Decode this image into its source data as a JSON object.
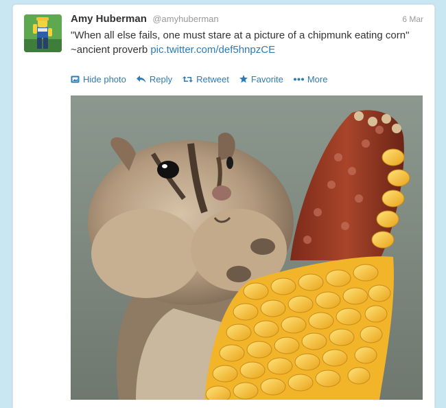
{
  "tweet": {
    "name": "Amy Huberman",
    "handle": "@amyhuberman",
    "date": "6 Mar",
    "text_line1": "\"When all else fails, one must stare at a picture of a chipmunk eating corn\"",
    "text_line2_prefix": "~ancient proverb ",
    "link": "pic.twitter.com/def5hnpzCE"
  },
  "actions": [
    {
      "label": "Hide photo",
      "icon": "photo-icon"
    },
    {
      "label": "Reply",
      "icon": "reply-arrow-icon"
    },
    {
      "label": "Retweet",
      "icon": "retweet-icon"
    },
    {
      "label": "Favorite",
      "icon": "star-icon"
    },
    {
      "label": "More",
      "icon": "dots-icon"
    }
  ],
  "colors": {
    "link": "#2b7bb9",
    "background": "#c9e6f3",
    "text": "#333333",
    "muted": "#999999"
  }
}
